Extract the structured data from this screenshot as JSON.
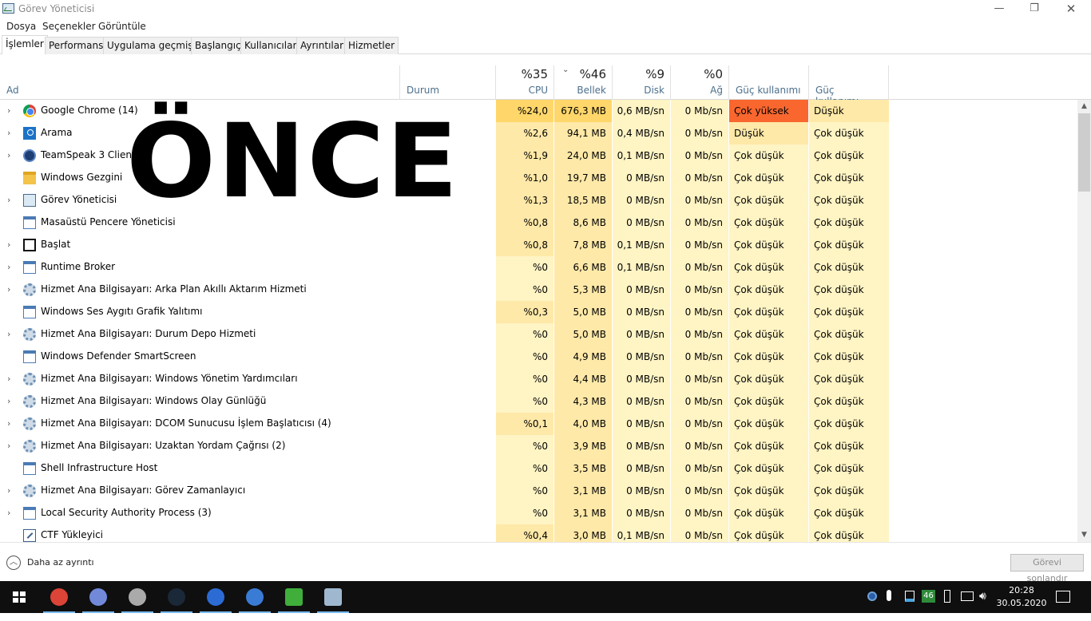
{
  "window": {
    "title": "Görev Yöneticisi",
    "controls": {
      "minimize": "—",
      "maximize": "❐",
      "close": "✕"
    }
  },
  "menu": [
    "Dosya",
    "Seçenekler",
    "Görüntüle"
  ],
  "tabs": [
    "İşlemler",
    "Performans",
    "Uygulama geçmişi",
    "Başlangıç",
    "Kullanıcılar",
    "Ayrıntılar",
    "Hizmetler"
  ],
  "active_tab": "İşlemler",
  "columns": {
    "name": "Ad",
    "status": "Durum",
    "cpu": {
      "pct": "%35",
      "label": "CPU"
    },
    "memory": {
      "pct": "%46",
      "label": "Bellek"
    },
    "disk": {
      "pct": "%9",
      "label": "Disk"
    },
    "network": {
      "pct": "%0",
      "label": "Ağ"
    },
    "power": "Güç kullanımı",
    "power_trend": "Güç kullanımı..."
  },
  "overlay_text": "ÖNCE",
  "processes": [
    {
      "name": "Google Chrome (14)",
      "icon": "chrome-icon",
      "expandable": true,
      "cpu": "%24,0",
      "mem": "676,3 MB",
      "disk": "0,6 MB/sn",
      "net": "0 Mb/sn",
      "power": "Çok yüksek",
      "power_trend": "Düşük"
    },
    {
      "name": "Arama",
      "icon": "search-icon",
      "expandable": true,
      "cpu": "%2,6",
      "mem": "94,1 MB",
      "disk": "0,4 MB/sn",
      "net": "0 Mb/sn",
      "power": "Düşük",
      "power_trend": "Çok düşük"
    },
    {
      "name": "TeamSpeak 3 Client",
      "icon": "teamspeak-icon",
      "expandable": true,
      "cpu": "%1,9",
      "mem": "24,0 MB",
      "disk": "0,1 MB/sn",
      "net": "0 Mb/sn",
      "power": "Çok düşük",
      "power_trend": "Çok düşük"
    },
    {
      "name": "Windows Gezgini",
      "icon": "folder-icon",
      "expandable": false,
      "cpu": "%1,0",
      "mem": "19,7 MB",
      "disk": "0 MB/sn",
      "net": "0 Mb/sn",
      "power": "Çok düşük",
      "power_trend": "Çok düşük"
    },
    {
      "name": "Görev Yöneticisi",
      "icon": "task-manager-icon",
      "expandable": true,
      "cpu": "%1,3",
      "mem": "18,5 MB",
      "disk": "0 MB/sn",
      "net": "0 Mb/sn",
      "power": "Çok düşük",
      "power_trend": "Çok düşük"
    },
    {
      "name": "Masaüstü Pencere Yöneticisi",
      "icon": "window-icon",
      "expandable": false,
      "cpu": "%0,8",
      "mem": "8,6 MB",
      "disk": "0 MB/sn",
      "net": "0 Mb/sn",
      "power": "Çok düşük",
      "power_trend": "Çok düşük"
    },
    {
      "name": "Başlat",
      "icon": "start-icon",
      "expandable": true,
      "cpu": "%0,8",
      "mem": "7,8 MB",
      "disk": "0,1 MB/sn",
      "net": "0 Mb/sn",
      "power": "Çok düşük",
      "power_trend": "Çok düşük"
    },
    {
      "name": "Runtime Broker",
      "icon": "window-icon",
      "expandable": true,
      "cpu": "%0",
      "mem": "6,6 MB",
      "disk": "0,1 MB/sn",
      "net": "0 Mb/sn",
      "power": "Çok düşük",
      "power_trend": "Çok düşük"
    },
    {
      "name": "Hizmet Ana Bilgisayarı: Arka Plan Akıllı Aktarım Hizmeti",
      "icon": "gear-icon",
      "expandable": true,
      "cpu": "%0",
      "mem": "5,3 MB",
      "disk": "0 MB/sn",
      "net": "0 Mb/sn",
      "power": "Çok düşük",
      "power_trend": "Çok düşük"
    },
    {
      "name": "Windows Ses Aygıtı Grafik Yalıtımı",
      "icon": "window-icon",
      "expandable": false,
      "cpu": "%0,3",
      "mem": "5,0 MB",
      "disk": "0 MB/sn",
      "net": "0 Mb/sn",
      "power": "Çok düşük",
      "power_trend": "Çok düşük"
    },
    {
      "name": "Hizmet Ana Bilgisayarı: Durum Depo Hizmeti",
      "icon": "gear-icon",
      "expandable": true,
      "cpu": "%0",
      "mem": "5,0 MB",
      "disk": "0 MB/sn",
      "net": "0 Mb/sn",
      "power": "Çok düşük",
      "power_trend": "Çok düşük"
    },
    {
      "name": "Windows Defender SmartScreen",
      "icon": "window-icon",
      "expandable": false,
      "cpu": "%0",
      "mem": "4,9 MB",
      "disk": "0 MB/sn",
      "net": "0 Mb/sn",
      "power": "Çok düşük",
      "power_trend": "Çok düşük"
    },
    {
      "name": "Hizmet Ana Bilgisayarı: Windows Yönetim Yardımcıları",
      "icon": "gear-icon",
      "expandable": true,
      "cpu": "%0",
      "mem": "4,4 MB",
      "disk": "0 MB/sn",
      "net": "0 Mb/sn",
      "power": "Çok düşük",
      "power_trend": "Çok düşük"
    },
    {
      "name": "Hizmet Ana Bilgisayarı: Windows Olay Günlüğü",
      "icon": "gear-icon",
      "expandable": true,
      "cpu": "%0",
      "mem": "4,3 MB",
      "disk": "0 MB/sn",
      "net": "0 Mb/sn",
      "power": "Çok düşük",
      "power_trend": "Çok düşük"
    },
    {
      "name": "Hizmet Ana Bilgisayarı: DCOM Sunucusu İşlem Başlatıcısı (4)",
      "icon": "gear-icon",
      "expandable": true,
      "cpu": "%0,1",
      "mem": "4,0 MB",
      "disk": "0 MB/sn",
      "net": "0 Mb/sn",
      "power": "Çok düşük",
      "power_trend": "Çok düşük"
    },
    {
      "name": "Hizmet Ana Bilgisayarı: Uzaktan Yordam Çağrısı (2)",
      "icon": "gear-icon",
      "expandable": true,
      "cpu": "%0",
      "mem": "3,9 MB",
      "disk": "0 MB/sn",
      "net": "0 Mb/sn",
      "power": "Çok düşük",
      "power_trend": "Çok düşük"
    },
    {
      "name": "Shell Infrastructure Host",
      "icon": "window-icon",
      "expandable": false,
      "cpu": "%0",
      "mem": "3,5 MB",
      "disk": "0 MB/sn",
      "net": "0 Mb/sn",
      "power": "Çok düşük",
      "power_trend": "Çok düşük"
    },
    {
      "name": "Hizmet Ana Bilgisayarı: Görev Zamanlayıcı",
      "icon": "gear-icon",
      "expandable": true,
      "cpu": "%0",
      "mem": "3,1 MB",
      "disk": "0 MB/sn",
      "net": "0 Mb/sn",
      "power": "Çok düşük",
      "power_trend": "Çok düşük"
    },
    {
      "name": "Local Security Authority Process (3)",
      "icon": "window-icon",
      "expandable": true,
      "cpu": "%0",
      "mem": "3,1 MB",
      "disk": "0 MB/sn",
      "net": "0 Mb/sn",
      "power": "Çok düşük",
      "power_trend": "Çok düşük"
    },
    {
      "name": "CTF Yükleyici",
      "icon": "ctf-icon",
      "expandable": false,
      "cpu": "%0,4",
      "mem": "3,0 MB",
      "disk": "0,1 MB/sn",
      "net": "0 Mb/sn",
      "power": "Çok düşük",
      "power_trend": "Çok düşük"
    }
  ],
  "footer": {
    "fewer_details": "Daha az ayrıntı",
    "end_task": "Görevi sonlandır"
  },
  "colors": {
    "heat_light": "#fff4c4",
    "heat_medium": "#ffe9a8",
    "heat_strong": "#ffd66a",
    "power_very_high": "#f9672f",
    "taskbar": "#0f0f0f"
  },
  "taskbar": {
    "apps": [
      {
        "name": "chrome-icon",
        "color": "#db4437"
      },
      {
        "name": "discord-icon",
        "color": "#7289da"
      },
      {
        "name": "obs-icon",
        "color": "#aaaaaa"
      },
      {
        "name": "steam-icon",
        "color": "#1b2838"
      },
      {
        "name": "teamspeak-icon",
        "color": "#2c6bd4"
      },
      {
        "name": "browser-icon",
        "color": "#3a7bd5"
      },
      {
        "name": "nvidia-icon",
        "color": "#3fae3a"
      },
      {
        "name": "task-manager-icon",
        "color": "#9fb8cf"
      }
    ],
    "tray_badge": "46",
    "time": "20:28",
    "date": "30.05.2020"
  }
}
